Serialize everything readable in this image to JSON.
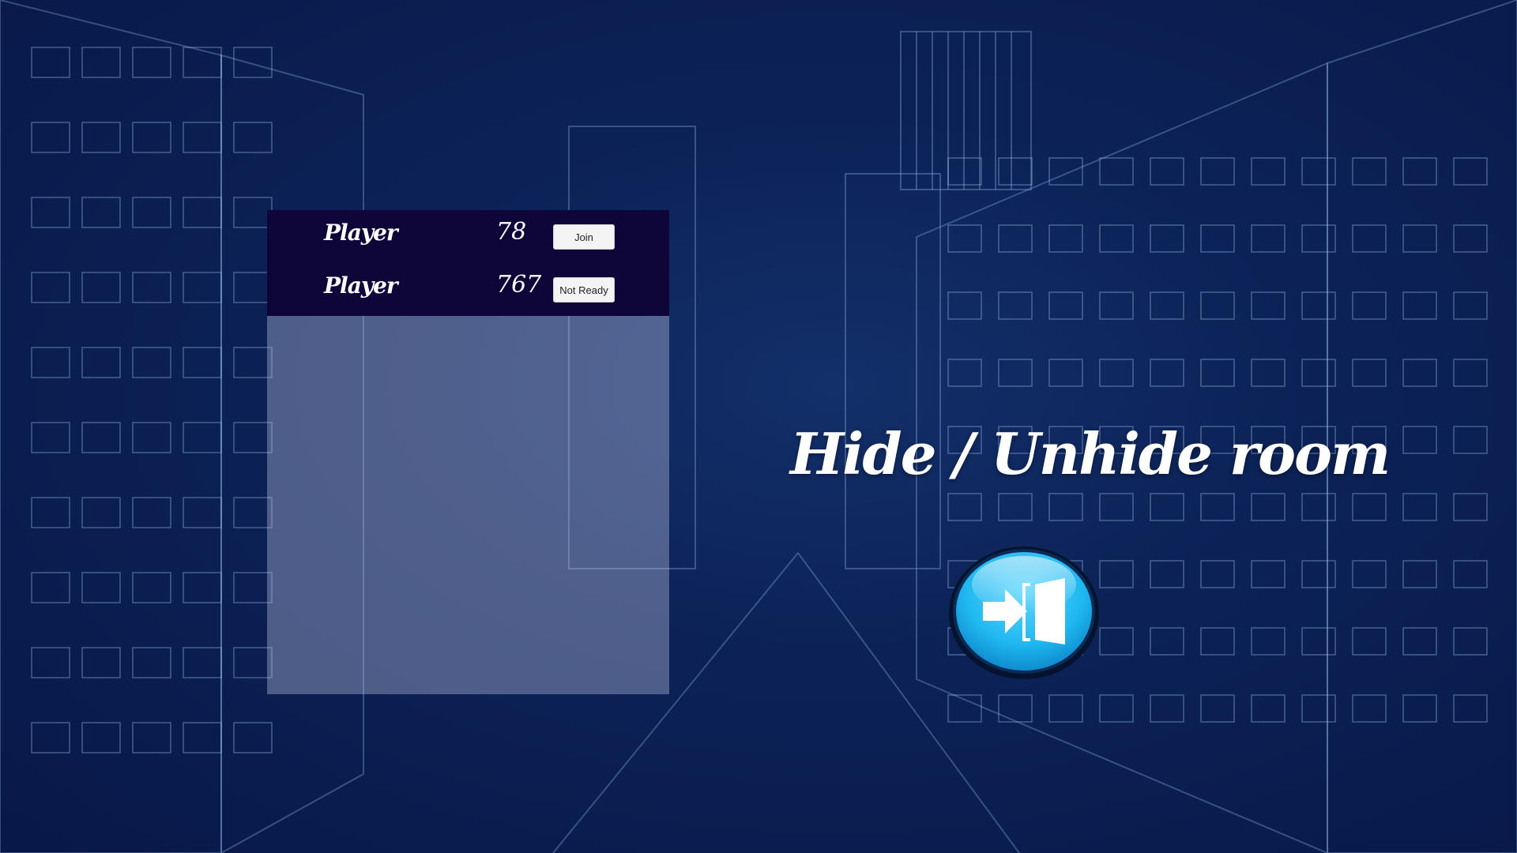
{
  "lobby": {
    "players": [
      {
        "name": "Player",
        "score": "78",
        "button_label": "Join"
      },
      {
        "name": "Player",
        "score": "767",
        "button_label": "Not Ready"
      }
    ]
  },
  "room_toggle": {
    "label": "Hide / Unhide room",
    "icon": "exit-door-icon"
  },
  "colors": {
    "background": "#0a1a45",
    "player_list_bg": "#0e0638",
    "exit_button_blue": "#1fb8f0"
  }
}
